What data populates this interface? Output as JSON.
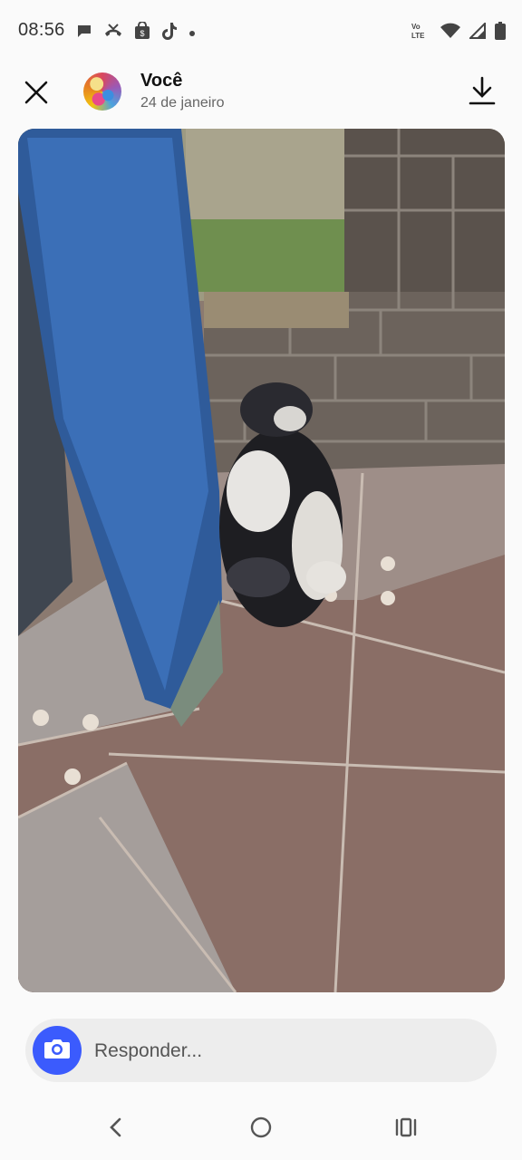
{
  "status_bar": {
    "time": "08:56",
    "left_icons": [
      "chat-bubble-icon",
      "missed-call-icon",
      "shopping-bag-icon",
      "tiktok-icon",
      "dot-icon"
    ],
    "right_icons": [
      "volte-icon",
      "wifi-icon",
      "signal-icon",
      "battery-icon"
    ],
    "volte_label": "Vo LTE"
  },
  "header": {
    "name": "Você",
    "date": "24 de janeiro",
    "close_icon": "close-icon",
    "download_icon": "download-icon"
  },
  "reply": {
    "placeholder": "Responder...",
    "camera_icon": "camera-icon",
    "camera_color": "#3b5bfd"
  },
  "nav": {
    "back_icon": "back-icon",
    "home_icon": "home-icon",
    "recents_icon": "recents-icon"
  }
}
